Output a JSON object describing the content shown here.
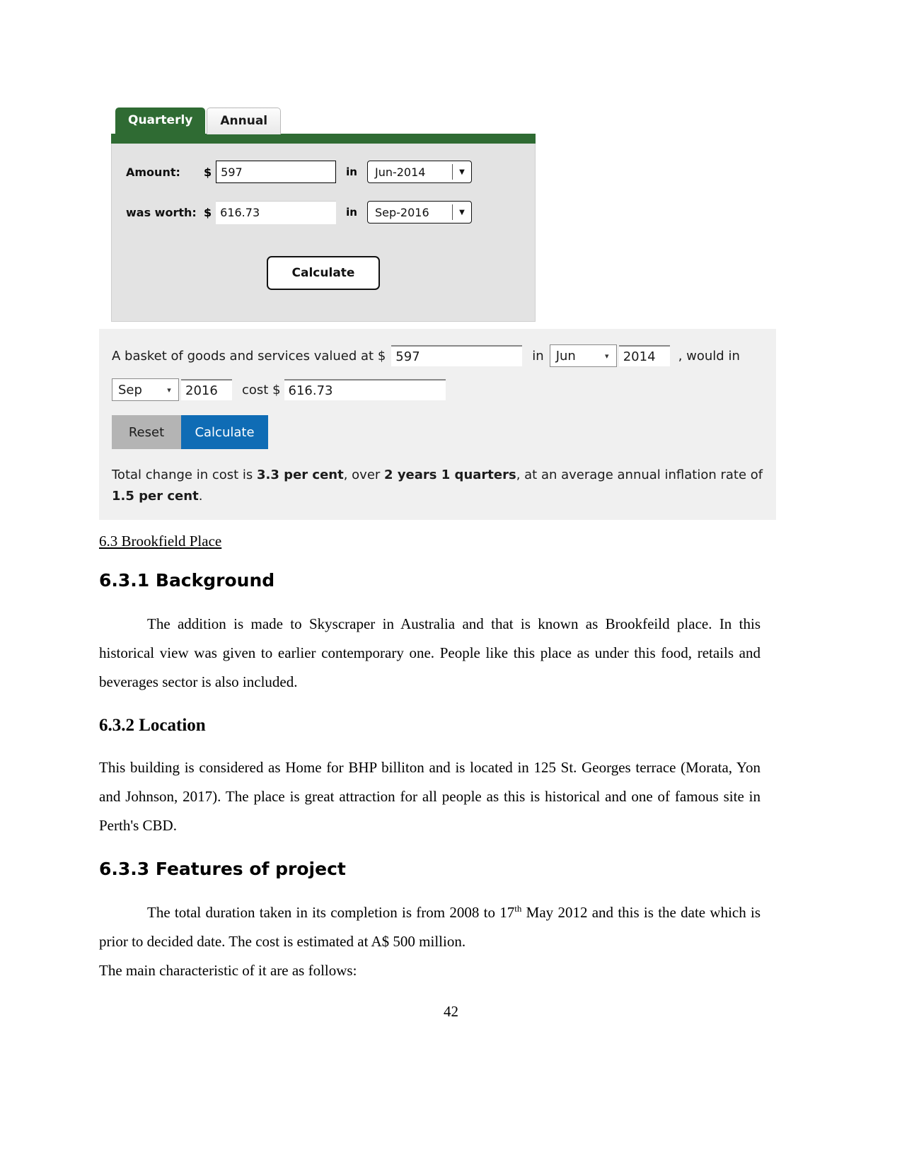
{
  "quarterly_calculator": {
    "tabs": [
      {
        "label": "Quarterly",
        "active": true
      },
      {
        "label": "Annual",
        "active": false
      }
    ],
    "rows": [
      {
        "label": "Amount:",
        "currency_symbol": "$",
        "value": "597",
        "connector": "in",
        "period": "Jun-2014"
      },
      {
        "label": "was worth:",
        "currency_symbol": "$",
        "value": "616.73",
        "connector": "in",
        "period": "Sep-2016"
      }
    ],
    "calculate_label": "Calculate",
    "accent_color": "#2f6b33",
    "body_color": "#e3e3e3"
  },
  "basket_calculator": {
    "lead_text": "A basket of goods and services valued at $",
    "amount_value": "597",
    "connector_in": "in",
    "from_month": "Jun",
    "from_year": "2014",
    "mid_text": ", would in",
    "to_month": "Sep",
    "to_year": "2016",
    "cost_text": "cost $",
    "cost_value": "616.73",
    "reset_label": "Reset",
    "calculate_label": "Calculate",
    "result": {
      "prefix": "Total change in cost is ",
      "change_pct": "3.3 per cent",
      "middle": ", over ",
      "duration": "2 years 1 quarters",
      "suffix": ", at an average annual inflation rate of ",
      "rate": "1.5 per cent",
      "end": "."
    },
    "reset_color": "#b4b4b4",
    "calculate_color": "#0f6cb5",
    "panel_color": "#f0f0f0"
  },
  "document": {
    "section_heading": "6.3 Brookfield Place",
    "background": {
      "heading": "6.3.1 Background",
      "paragraph": "The addition is made to Skyscraper in Australia and that is known as Brookfeild place. In this historical view was given to earlier contemporary one. People like this place as under this food, retails and beverages sector is also included."
    },
    "location": {
      "heading": "6.3.2 Location",
      "paragraph": "This building is considered as  Home for BHP billiton and is located in 125 St. Georges terrace (Morata, Yon and Johnson, 2017). The place is great attraction for all people as this is historical and one of famous site in Perth's CBD."
    },
    "features": {
      "heading": "6.3.3 Features of project",
      "paragraph_part1": "The total duration taken in its completion is from 2008 to 17",
      "paragraph_superscript": "th",
      "paragraph_part2": " May 2012 and this is the date which is prior to decided date. The cost is estimated at A$ 500 million.",
      "closing_line": "The main characteristic of it are as follows:"
    },
    "page_number": "42"
  }
}
